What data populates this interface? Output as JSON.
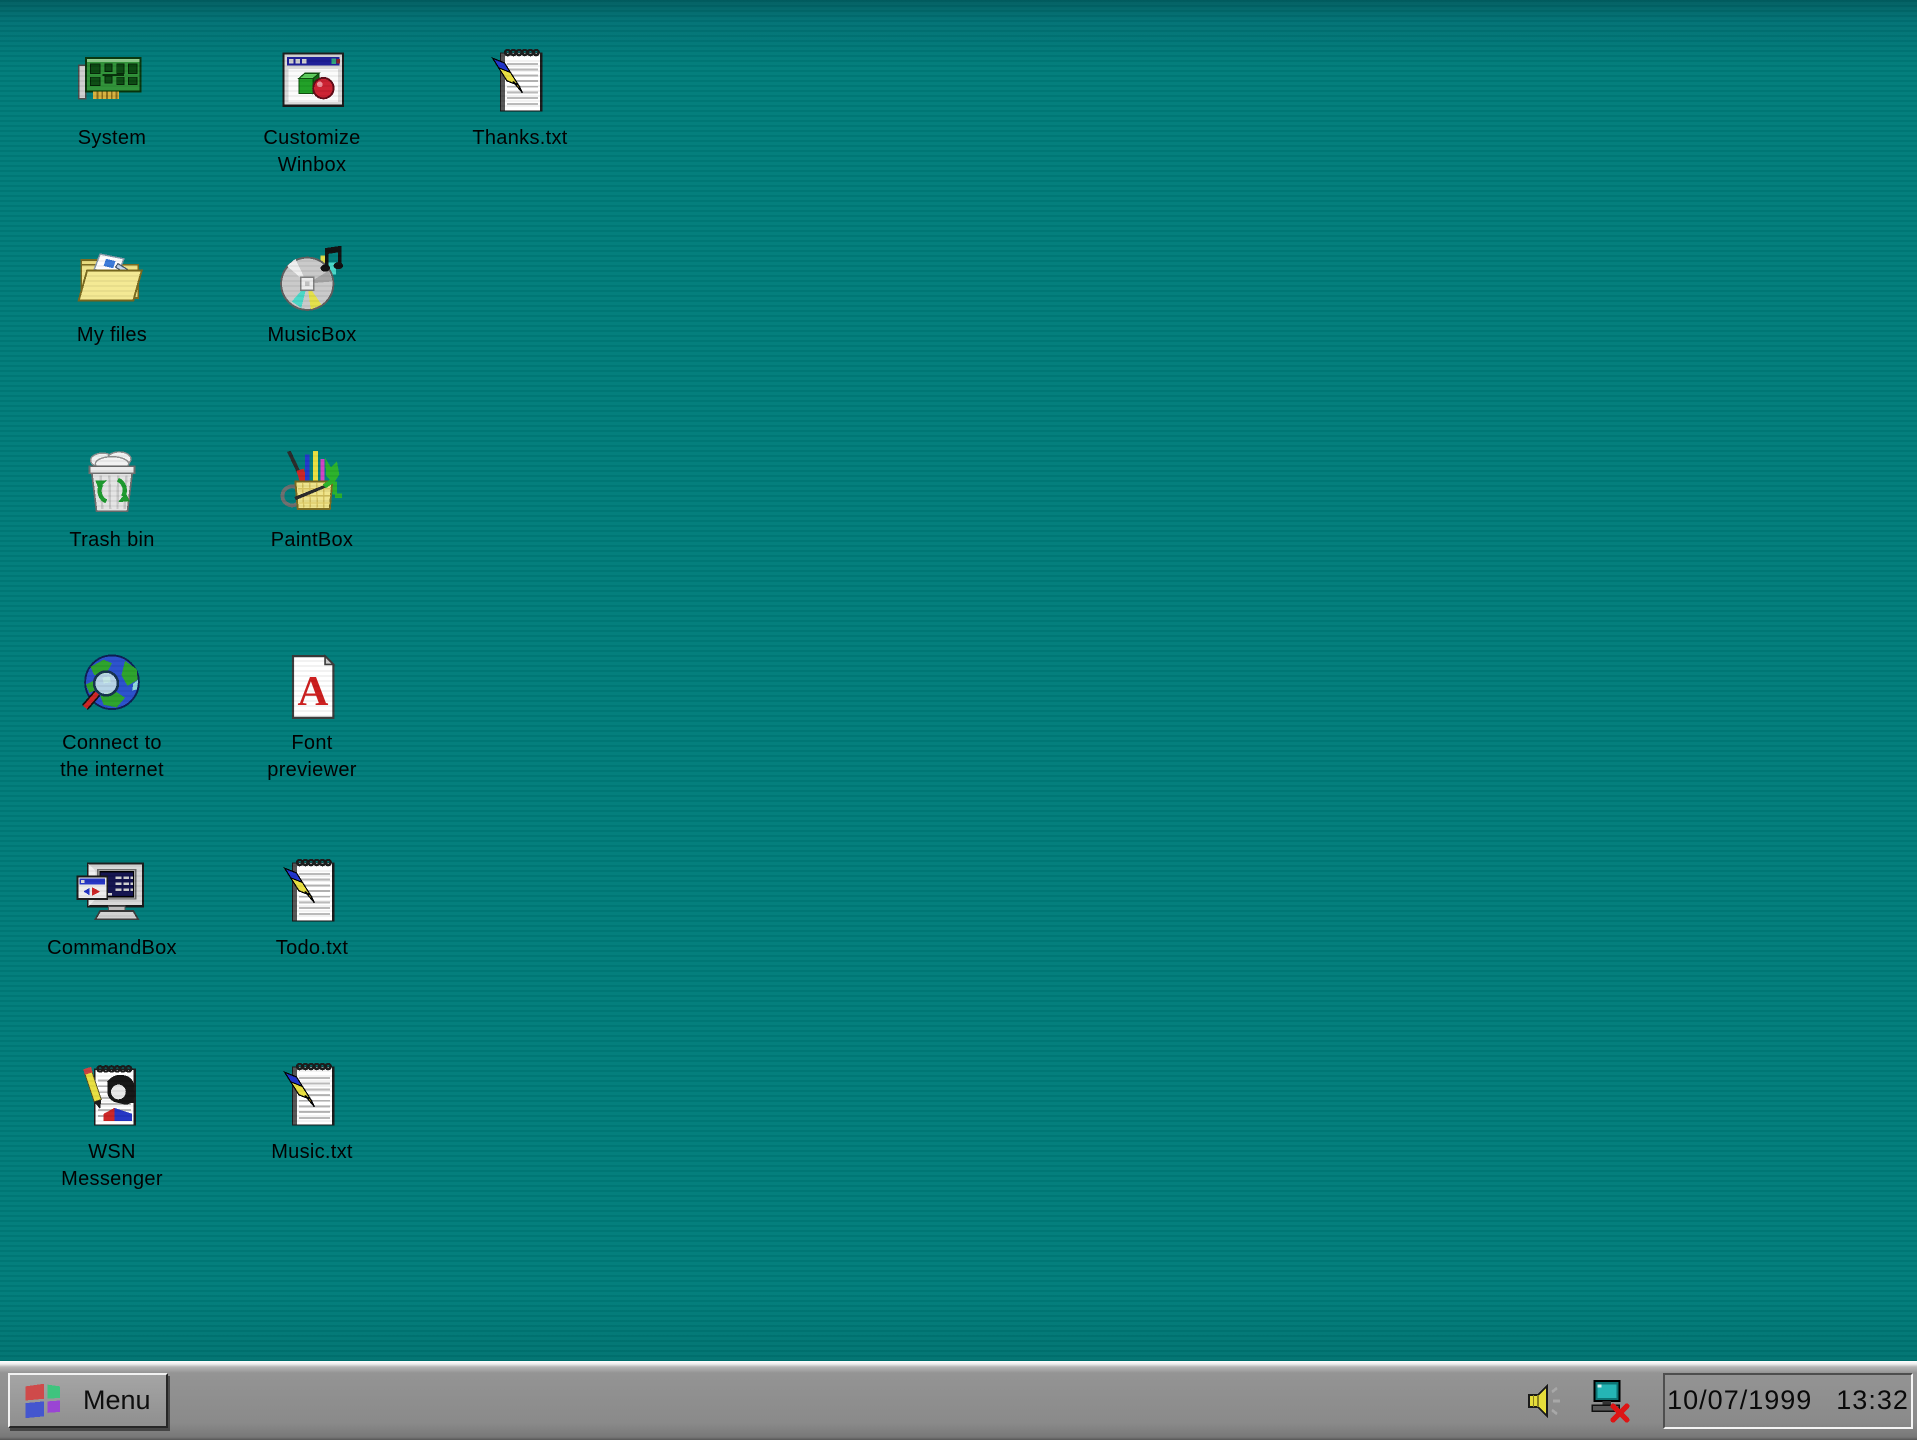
{
  "desktop": {
    "background_color": "#007c7a",
    "label_color": "#000000",
    "icons": [
      {
        "label": "System",
        "icon": "network-card-icon"
      },
      {
        "label": "Customize\nWinbox",
        "icon": "winbox-window-icon"
      },
      {
        "label": "Thanks.txt",
        "icon": "notepad-pen-icon"
      },
      {
        "label": "My files",
        "icon": "folder-files-icon"
      },
      {
        "label": "MusicBox",
        "icon": "cd-music-note-icon"
      },
      {
        "label": "Trash bin",
        "icon": "trash-recycle-icon"
      },
      {
        "label": "PaintBox",
        "icon": "paint-cup-icon"
      },
      {
        "label": "Connect to\nthe internet",
        "icon": "globe-magnifier-icon"
      },
      {
        "label": "Font\npreviewer",
        "icon": "font-page-a-icon"
      },
      {
        "label": "CommandBox",
        "icon": "monitor-window-icon"
      },
      {
        "label": "Todo.txt",
        "icon": "notepad-pen-icon"
      },
      {
        "label": "WSN\nMessenger",
        "icon": "messenger-notepad-icon"
      },
      {
        "label": "Music.txt",
        "icon": "notepad-pen-icon"
      }
    ]
  },
  "taskbar": {
    "background_color": "#8f8f8f",
    "menu_label": "Menu",
    "menu_flag_colors": [
      "#cf4a4a",
      "#3fc47e",
      "#4456cf",
      "#9a45d4"
    ],
    "tray": {
      "volume": "volume-speaker-icon",
      "network": "network-disconnected-icon"
    },
    "clock": {
      "date": "10/07/1999",
      "time": "13:32"
    }
  }
}
